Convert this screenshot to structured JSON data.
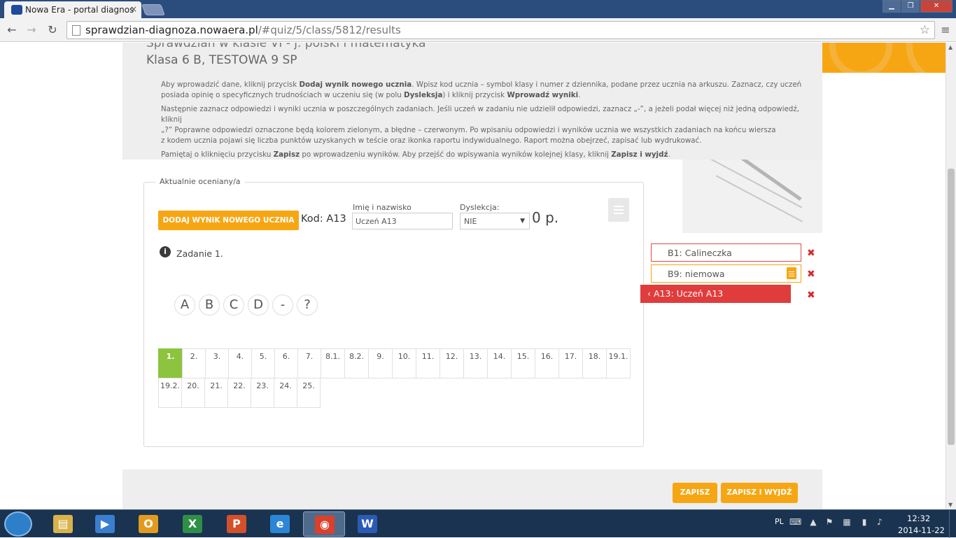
{
  "browser": {
    "tab_title": "Nowa Era - portal diagnos",
    "tab_close": "×",
    "url_domain": "sprawdzian-diagnoza.nowaera.pl",
    "url_path": "/#quiz/5/class/5812/results",
    "window_buttons": {
      "minimize": "▁",
      "maximize": "❐",
      "close": "✕"
    },
    "nav": {
      "back": "←",
      "forward": "→",
      "reload": "↻",
      "star": "☆",
      "menu": "≡"
    }
  },
  "page": {
    "quiz_title": "Sprawdzian w klasie VI - j. polski i matematyka",
    "class_title": "Klasa 6 B, TESTOWA 9 SP",
    "instructions": {
      "p1": {
        "t1": "Aby wprowadzić dane, kliknij przycisk ",
        "b1": "Dodaj wynik nowego ucznia",
        "t2": ". Wpisz kod ucznia – symbol klasy i numer z dziennika, podane przez ucznia na arkuszu. Zaznacz, czy uczeń posiada opinię o specyficznych trudnościach w uczeniu się (w polu ",
        "b2": "Dysleksja",
        "t3": ") i kliknij przycisk ",
        "b3": "Wprowadź wyniki",
        "t4": "."
      },
      "p2": {
        "line1": "Następnie zaznacz odpowiedzi i wyniki ucznia w poszczególnych zadaniach. Jeśli uczeń w zadaniu nie udzielił odpowiedzi, zaznacz „-”, a jeżeli podał więcej niż jedną odpowiedź, kliknij",
        "line2": "„?” Poprawne odpowiedzi oznaczone będą kolorem zielonym, a błędne – czerwonym. Po wpisaniu odpowiedzi i wyników ucznia we wszystkich zadaniach na końcu wiersza",
        "line3": "z kodem ucznia pojawi się liczba punktów uzyskanych w teście oraz ikonka raportu indywidualnego. Raport można obejrzeć, zapisać lub wydrukować."
      },
      "p3": {
        "t1": "Pamiętaj o kliknięciu przycisku ",
        "b1": "Zapisz",
        "t2": " po wprowadzeniu wyników. Aby przejść do wpisywania wyników kolejnej klasy, kliknij ",
        "b2": "Zapisz i wyjdź",
        "t3": "."
      }
    },
    "panel": {
      "legend": "Aktualnie oceniany/a",
      "add_button": "DODAJ WYNIK NOWEGO UCZNIA",
      "kod": "Kod: A13",
      "name_label": "Imię i nazwisko",
      "name_value": "Uczeń A13",
      "dyslexia_label": "Dyslekcja:",
      "dyslexia_value": "NIE",
      "points": "0 p.",
      "task_title": "Zadanie 1.",
      "info_glyph": "i",
      "answers": [
        "A",
        "B",
        "C",
        "D",
        "-",
        "?"
      ],
      "tasks_row1": [
        "1.",
        "2.",
        "3.",
        "4.",
        "5.",
        "6.",
        "7.",
        "8.1.",
        "8.2.",
        "9.",
        "10.",
        "11.",
        "12.",
        "13.",
        "14.",
        "15.",
        "16.",
        "17.",
        "18.",
        "19.1."
      ],
      "tasks_row2": [
        "19.2.",
        "20.",
        "21.",
        "22.",
        "23.",
        "24.",
        "25."
      ],
      "active_task": "1."
    },
    "students": [
      {
        "label": "B1: Calineczka",
        "state": "red-outline"
      },
      {
        "label": "B9: niemowa",
        "state": "orange-outline",
        "has_report": true
      },
      {
        "label": "A13: Uczeń A13",
        "state": "selected"
      }
    ],
    "student_chevron": "‹",
    "delete_glyph": "✖",
    "footer": {
      "save": "ZAPISZ",
      "save_exit": "ZAPISZ I WYJDŹ"
    },
    "colors": {
      "orange": "#f7a613",
      "red": "#e03c3c",
      "green": "#8cc43f"
    }
  },
  "taskbar": {
    "apps": [
      {
        "name": "file-explorer-icon",
        "glyph": "▤",
        "color": "#d8b34a"
      },
      {
        "name": "media-player-icon",
        "glyph": "▶",
        "color": "#3a7fcf"
      },
      {
        "name": "outlook-icon",
        "glyph": "O",
        "color": "#e39b1e"
      },
      {
        "name": "excel-icon",
        "glyph": "X",
        "color": "#2f8f46"
      },
      {
        "name": "powerpoint-icon",
        "glyph": "P",
        "color": "#d2512b"
      },
      {
        "name": "internet-explorer-icon",
        "glyph": "e",
        "color": "#2b86d6"
      },
      {
        "name": "chrome-icon",
        "glyph": "◉",
        "color": "#d9412c"
      },
      {
        "name": "word-icon",
        "glyph": "W",
        "color": "#2b5bb5"
      }
    ],
    "active_app": "chrome-icon",
    "lang": "PL",
    "tray_icons": [
      "⌨",
      "▲",
      "⚑",
      "▦",
      "▮",
      "♪"
    ],
    "time": "12:32",
    "date": "2014-11-22"
  }
}
